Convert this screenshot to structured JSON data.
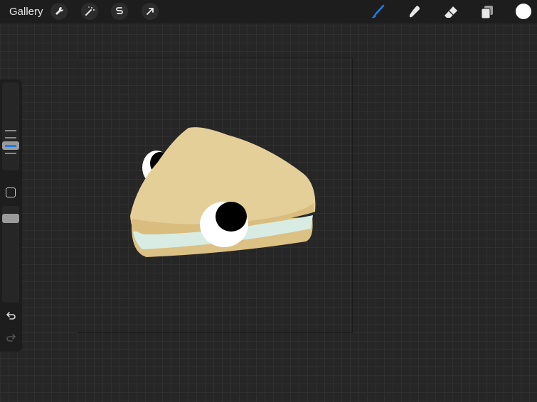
{
  "toolbar": {
    "gallery_label": "Gallery",
    "left_tools": [
      "wrench-icon",
      "magic-wand-icon",
      "selection-icon",
      "transform-arrow-icon"
    ],
    "right_tools": [
      "brush-icon",
      "smudge-icon",
      "eraser-icon",
      "layers-icon"
    ],
    "active_tool": "brush-icon",
    "accent_color": "#1a7cf0",
    "current_color": "#ffffff"
  },
  "sidebar": {
    "brush_size_level": 0.45,
    "opacity_level": 0.55,
    "modify_button_icon": "square-outline-icon",
    "undo_icon": "undo-icon",
    "redo_icon": "redo-icon"
  },
  "artwork": {
    "subject": "sandwich-with-eyes",
    "colors": {
      "bread": "#e5cf98",
      "crust": "#d8bd7e",
      "filling": "#d8ece3",
      "eye_white": "#ffffff",
      "pupil": "#000000"
    }
  }
}
